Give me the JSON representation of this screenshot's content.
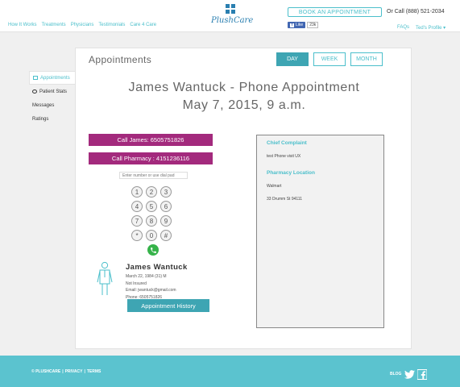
{
  "header": {
    "nav": [
      "How It Works",
      "Treatments",
      "Physicians",
      "Testimonials",
      "Care 4 Care"
    ],
    "logo_text": "PlushCare",
    "book_label": "BOOK AN APPOINTMENT",
    "call_text": "Or Call (888) 521-2034",
    "fb_like_label": "Like",
    "fb_count": "23k",
    "faqs_label": "FAQs",
    "profile_label": "Ted's Profile ▾"
  },
  "sidebar": {
    "items": [
      {
        "label": "Appointments"
      },
      {
        "label": "Patient Stats"
      },
      {
        "label": "Messages"
      },
      {
        "label": "Ratings"
      }
    ]
  },
  "main": {
    "title": "Appointments",
    "views": [
      "DAY",
      "WEEK",
      "MONTH"
    ],
    "headline": "James Wantuck - Phone Appointment",
    "date": "May 7, 2015, 9 a.m.",
    "call_patient_label": "Call James: 6505751826",
    "call_pharmacy_label": "Call Pharmacy : 4151236116",
    "dial_placeholder": "Enter number or use dial pad",
    "dialpad_keys": [
      "1",
      "2",
      "3",
      "4",
      "5",
      "6",
      "7",
      "8",
      "9",
      "*",
      "0",
      "#"
    ],
    "patient": {
      "name": "James Wantuck",
      "dob": "March 22, 1984 (31) M",
      "insurance": "Not Insured",
      "email": "Email: jwantuck@gmail.com",
      "phone": "Phone: 6505751826"
    },
    "history_label": "Appointment History",
    "complaint": {
      "heading": "Chief Complaint",
      "text": "test Phone visit UX"
    },
    "pharmacy": {
      "heading": "Pharmacy Location",
      "name": "Walmart",
      "address": "33 Drumm St 94111"
    }
  },
  "footer": {
    "copyright": "© PLUSHCARE",
    "privacy": "PRIVACY",
    "terms": "TERMS",
    "sep": "|",
    "blog": "BLOG"
  },
  "colors": {
    "accent": "#4bbfcb",
    "brand_blue": "#2a7fb0",
    "call_purple": "#a32a7d",
    "call_green": "#36b34a",
    "footer_bg": "#5bc3cf"
  }
}
